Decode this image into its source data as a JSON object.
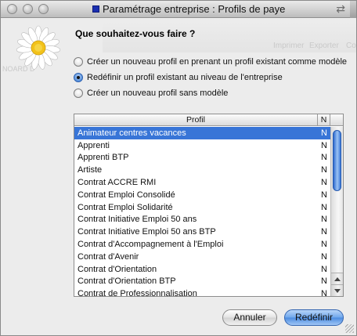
{
  "window": {
    "title": "Paramétrage entreprise : Profils de paye"
  },
  "background_toolbar": {
    "left_label": "NOARD D",
    "items": [
      "Imprimer",
      "Exporter",
      "Co"
    ]
  },
  "dialog": {
    "question": "Que souhaitez-vous faire ?",
    "options": [
      {
        "label": "Créer un nouveau profil en prenant un profil existant comme modèle",
        "selected": false
      },
      {
        "label": "Redéfinir un profil existant au niveau de l'entreprise",
        "selected": true
      },
      {
        "label": "Créer un nouveau profil sans modèle",
        "selected": false
      }
    ],
    "table": {
      "columns": [
        "Profil",
        "N"
      ],
      "rows": [
        {
          "name": "Animateur centres vacances",
          "n": "N",
          "selected": true
        },
        {
          "name": "Apprenti",
          "n": "N"
        },
        {
          "name": "Apprenti BTP",
          "n": "N"
        },
        {
          "name": "Artiste",
          "n": "N"
        },
        {
          "name": "Contrat ACCRE RMI",
          "n": "N"
        },
        {
          "name": "Contrat Emploi Consolidé",
          "n": "N"
        },
        {
          "name": "Contrat Emploi Solidarité",
          "n": "N"
        },
        {
          "name": "Contrat Initiative Emploi 50 ans",
          "n": "N"
        },
        {
          "name": "Contrat Initiative Emploi 50 ans BTP",
          "n": "N"
        },
        {
          "name": "Contrat d'Accompagnement à l'Emploi",
          "n": "N"
        },
        {
          "name": "Contrat d'Avenir",
          "n": "N"
        },
        {
          "name": "Contrat d'Orientation",
          "n": "N"
        },
        {
          "name": "Contrat d'Orientation BTP",
          "n": "N"
        },
        {
          "name": "Contrat de Professionnalisation",
          "n": "N"
        }
      ]
    },
    "buttons": {
      "cancel": "Annuler",
      "ok": "Redéfinir"
    }
  },
  "colors": {
    "selection": "#3875d7",
    "accent_button": "#6fa7ec",
    "title_icon": "#1b2fb0"
  },
  "icons": [
    "window-close-icon",
    "window-minimize-icon",
    "window-zoom-icon",
    "document-icon",
    "sync-arrows-icon",
    "daisy-icon",
    "scroll-up-icon",
    "scroll-down-icon",
    "resize-grip-icon"
  ]
}
